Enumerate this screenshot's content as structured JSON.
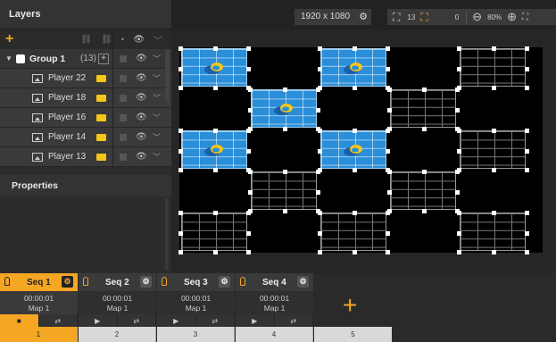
{
  "layers_panel": {
    "title": "Layers",
    "group": {
      "label": "Group 1",
      "count": "(13)"
    },
    "players": [
      {
        "label": "Player 22"
      },
      {
        "label": "Player 18"
      },
      {
        "label": "Player 16"
      },
      {
        "label": "Player 14"
      },
      {
        "label": "Player 13"
      }
    ]
  },
  "properties_panel": {
    "title": "Properties"
  },
  "toolbar": {
    "resolution": "1920 x 1080",
    "count_a": "13",
    "count_b": "0",
    "zoom": "80%"
  },
  "colors": {
    "accent": "#f5a623",
    "tile_blue": "#2a8ed9"
  },
  "sequences": [
    {
      "label": "Seq 1",
      "time": "00:00:01",
      "map": "Map 1",
      "number": "1",
      "active": true
    },
    {
      "label": "Seq 2",
      "time": "00:00:01",
      "map": "Map 1",
      "number": "2",
      "active": false
    },
    {
      "label": "Seq 3",
      "time": "00:00:01",
      "map": "Map 1",
      "number": "3",
      "active": false
    },
    {
      "label": "Seq 4",
      "time": "00:00:01",
      "map": "Map 1",
      "number": "4",
      "active": false
    }
  ],
  "empty_slot_number": "5"
}
